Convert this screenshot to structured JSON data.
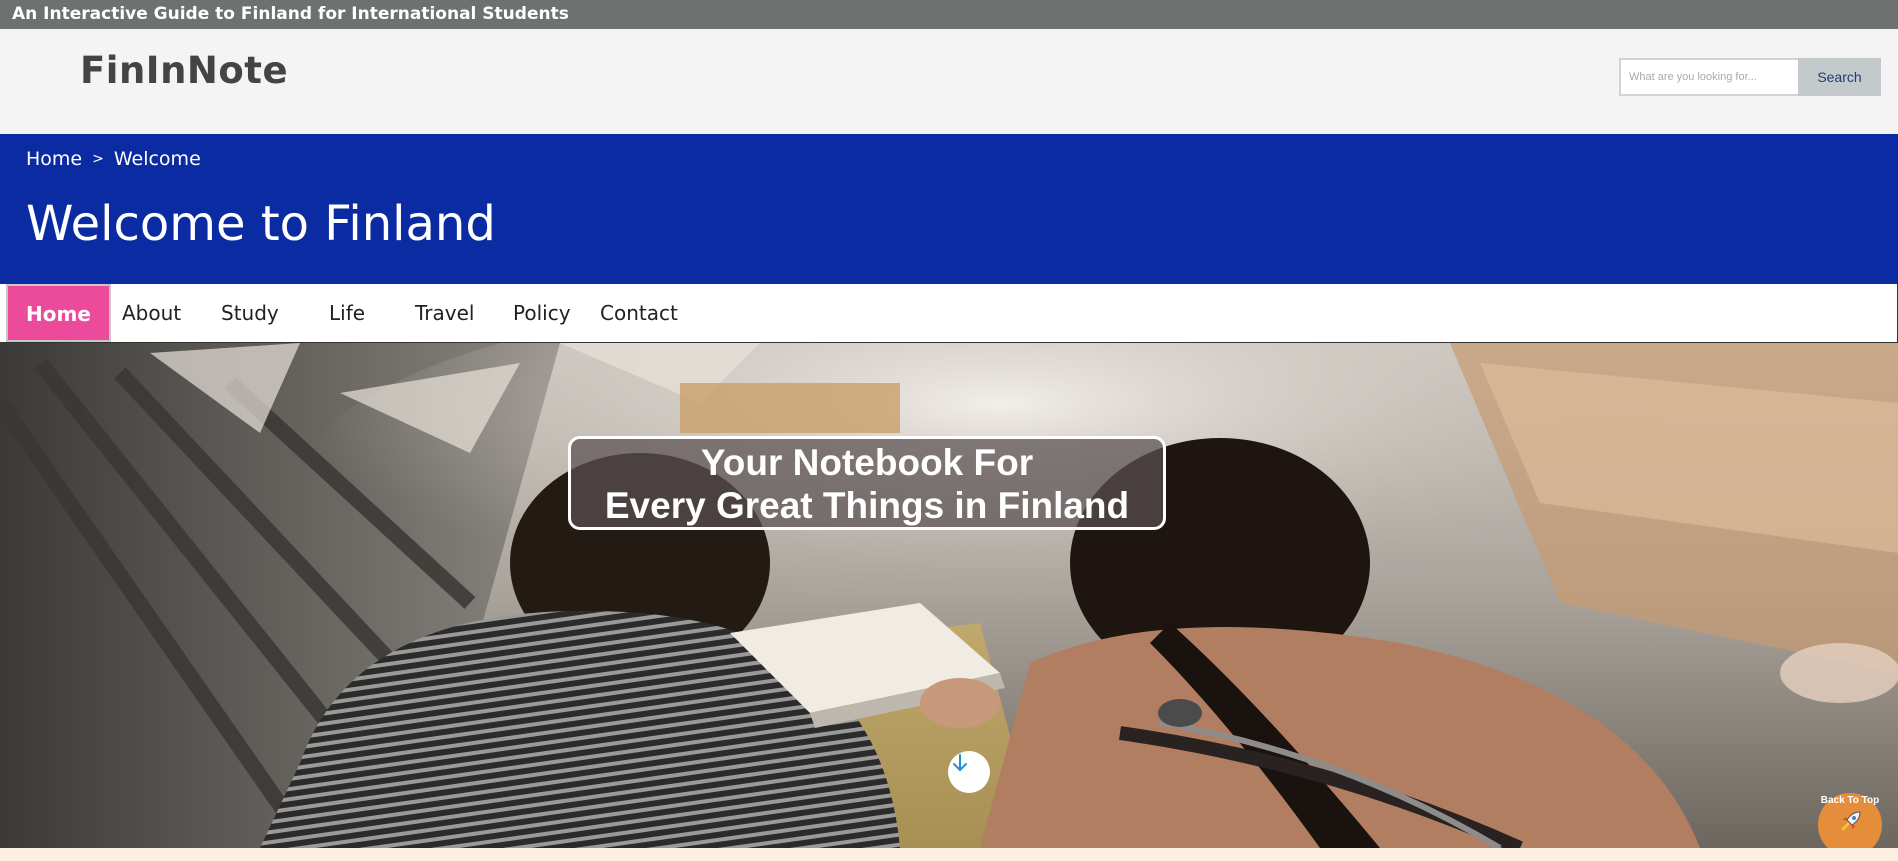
{
  "topbar": {
    "tagline": "An Interactive Guide to Finland for International Students"
  },
  "header": {
    "logo": "FinInNote",
    "search": {
      "placeholder": "What are you looking for...",
      "button_label": "Search"
    }
  },
  "banner": {
    "breadcrumb": {
      "home": "Home",
      "separator": ">",
      "current": "Welcome"
    },
    "title": "Welcome to Finland"
  },
  "nav": {
    "items": [
      {
        "label": "Home",
        "active": true
      },
      {
        "label": "About"
      },
      {
        "label": "Study"
      },
      {
        "label": "Life"
      },
      {
        "label": "Travel"
      },
      {
        "label": "Policy"
      },
      {
        "label": "Contact"
      }
    ]
  },
  "hero": {
    "caption_line1": "Your Notebook For",
    "caption_line2": "Every Great Things in Finland",
    "scroll_icon": "arrow-down-icon"
  },
  "back_to_top": {
    "label": "Back To Top",
    "icon": "rocket-icon"
  },
  "colors": {
    "topbar": "#6d7270",
    "banner": "#0b2ba3",
    "nav_active": "#ec4a9b",
    "search_button": "#c4c9cc",
    "back_to_top": "#e48d3a"
  }
}
